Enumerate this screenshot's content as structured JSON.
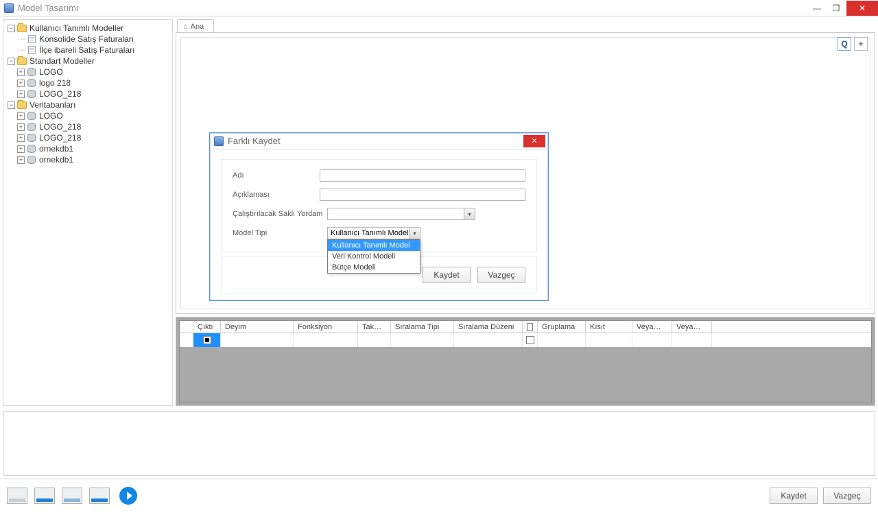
{
  "window": {
    "title": "Model Tasarımı"
  },
  "tree": {
    "root1": "Kullanıcı Tanımlı Modeller",
    "root1_items": [
      "Konsolide Satış Faturaları",
      "İlçe ibareli Satış Faturaları"
    ],
    "root2": "Standart Modeller",
    "root2_items": [
      "LOGO",
      "logo 218",
      "LOGO_218"
    ],
    "root3": "Veritabanları",
    "root3_items": [
      "LOGO",
      "LOGO_218",
      "LOGO_218",
      "ornekdb1",
      "ornekdb1"
    ]
  },
  "tab": {
    "main": "Ana"
  },
  "toolbar": {
    "q": "Q",
    "plus": "+"
  },
  "dialog": {
    "title": "Farklı Kaydet",
    "fields": {
      "name": "Adı",
      "desc": "Açıklaması",
      "sp": "Çalıştırılacak Saklı Yordam",
      "type": "Model Tipi"
    },
    "type_value": "Kullanıcı Tanımlı Model",
    "type_options": [
      "Kullanıcı Tanımlı Model",
      "Veri Kontrol Modeli",
      "Bütçe Modeli"
    ],
    "save": "Kaydet",
    "cancel": "Vazgeç"
  },
  "grid": {
    "cols": [
      "Çıktı",
      "Deyim",
      "Fonksiyon",
      "Tak…",
      "Sıralama Tipi",
      "Sıralama Düzeni",
      "",
      "Gruplama",
      "Kısıt",
      "Veya…",
      "Veya…"
    ]
  },
  "footer": {
    "save": "Kaydet",
    "cancel": "Vazgeç"
  }
}
